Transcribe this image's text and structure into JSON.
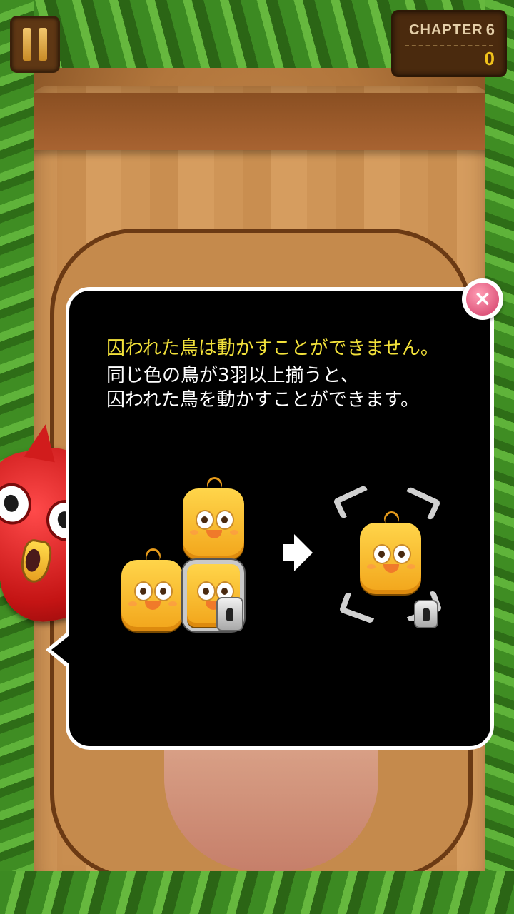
{
  "hud": {
    "chapter_label": "CHAPTER",
    "chapter_number": "6",
    "score": "0"
  },
  "dialog": {
    "line1": "囚われた鳥は動かすことができません。",
    "line2": "同じ色の鳥が3羽以上揃うと、",
    "line3": "囚われた鳥を動かすことができます。",
    "close_label": "×"
  },
  "colors": {
    "highlight_text": "#f2e13a",
    "close_button": "#d23c68",
    "score": "#f0c21b"
  },
  "icons": [
    "pause-icon",
    "close-icon",
    "arrow-right-icon",
    "lock-icon",
    "yellow-chick-icon",
    "red-bird-mascot"
  ]
}
